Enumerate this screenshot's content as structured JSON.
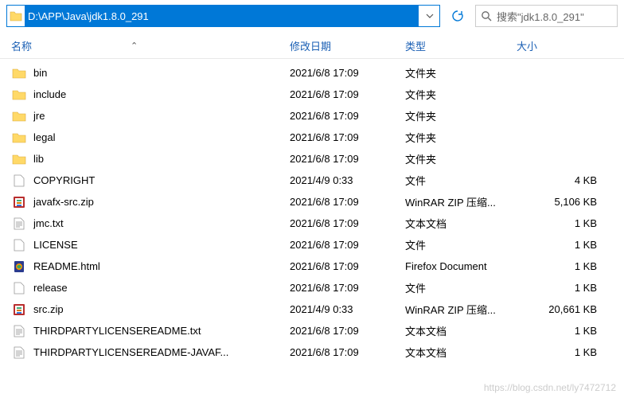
{
  "address": {
    "path": "D:\\APP\\Java\\jdk1.8.0_291"
  },
  "search": {
    "placeholder": "搜索\"jdk1.8.0_291\""
  },
  "columns": {
    "name": "名称",
    "date": "修改日期",
    "type": "类型",
    "size": "大小"
  },
  "files": [
    {
      "icon": "folder",
      "name": "bin",
      "date": "2021/6/8 17:09",
      "type": "文件夹",
      "size": ""
    },
    {
      "icon": "folder",
      "name": "include",
      "date": "2021/6/8 17:09",
      "type": "文件夹",
      "size": ""
    },
    {
      "icon": "folder",
      "name": "jre",
      "date": "2021/6/8 17:09",
      "type": "文件夹",
      "size": ""
    },
    {
      "icon": "folder",
      "name": "legal",
      "date": "2021/6/8 17:09",
      "type": "文件夹",
      "size": ""
    },
    {
      "icon": "folder",
      "name": "lib",
      "date": "2021/6/8 17:09",
      "type": "文件夹",
      "size": ""
    },
    {
      "icon": "file",
      "name": "COPYRIGHT",
      "date": "2021/4/9 0:33",
      "type": "文件",
      "size": "4 KB"
    },
    {
      "icon": "zip",
      "name": "javafx-src.zip",
      "date": "2021/6/8 17:09",
      "type": "WinRAR ZIP 压缩...",
      "size": "5,106 KB"
    },
    {
      "icon": "txt",
      "name": "jmc.txt",
      "date": "2021/6/8 17:09",
      "type": "文本文档",
      "size": "1 KB"
    },
    {
      "icon": "file",
      "name": "LICENSE",
      "date": "2021/6/8 17:09",
      "type": "文件",
      "size": "1 KB"
    },
    {
      "icon": "html",
      "name": "README.html",
      "date": "2021/6/8 17:09",
      "type": "Firefox Document",
      "size": "1 KB"
    },
    {
      "icon": "file",
      "name": "release",
      "date": "2021/6/8 17:09",
      "type": "文件",
      "size": "1 KB"
    },
    {
      "icon": "zip",
      "name": "src.zip",
      "date": "2021/4/9 0:33",
      "type": "WinRAR ZIP 压缩...",
      "size": "20,661 KB"
    },
    {
      "icon": "txt",
      "name": "THIRDPARTYLICENSEREADME.txt",
      "date": "2021/6/8 17:09",
      "type": "文本文档",
      "size": "1 KB"
    },
    {
      "icon": "txt",
      "name": "THIRDPARTYLICENSEREADME-JAVAF...",
      "date": "2021/6/8 17:09",
      "type": "文本文档",
      "size": "1 KB"
    }
  ],
  "watermark": "https://blog.csdn.net/ly7472712"
}
